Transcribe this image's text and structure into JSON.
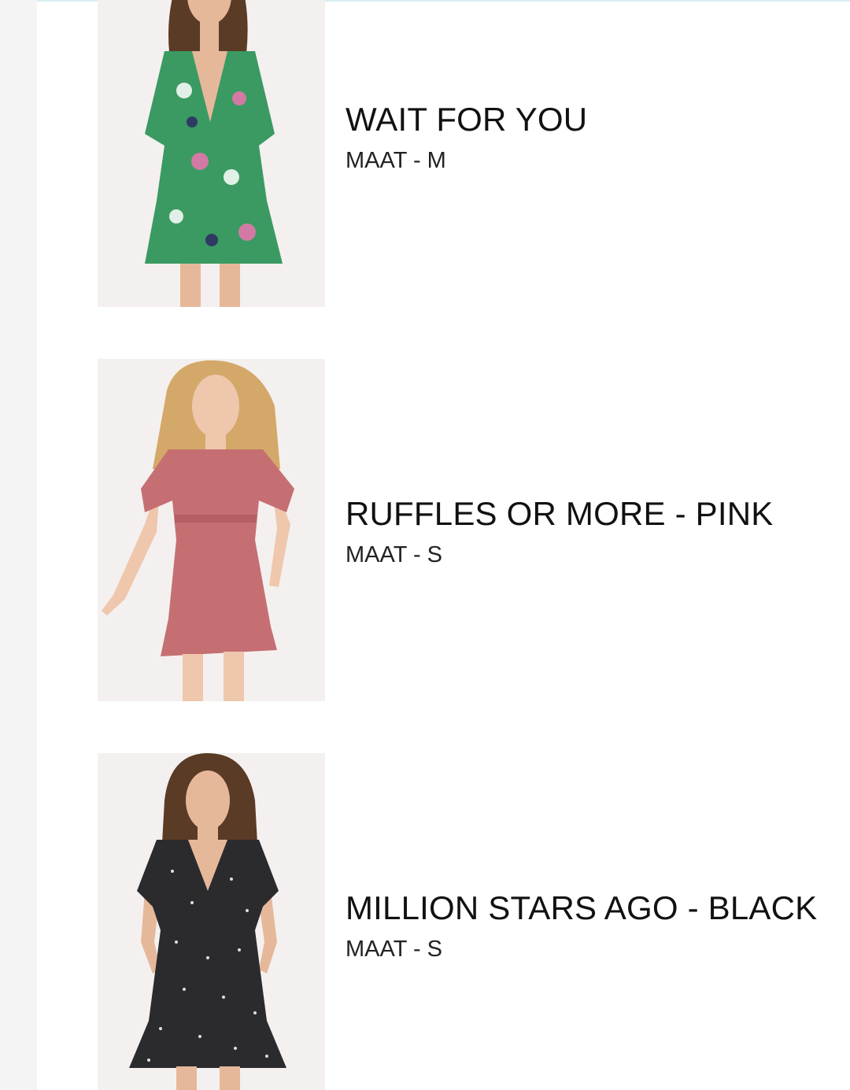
{
  "products": [
    {
      "title": "WAIT FOR YOU",
      "size": "MAAT - M",
      "dress_color": "#3a9a62"
    },
    {
      "title": "RUFFLES OR MORE - PINK",
      "size": "MAAT - S",
      "dress_color": "#c56f72"
    },
    {
      "title": "MILLION STARS AGO - BLACK",
      "size": "MAAT - S",
      "dress_color": "#2b2b2e"
    }
  ]
}
